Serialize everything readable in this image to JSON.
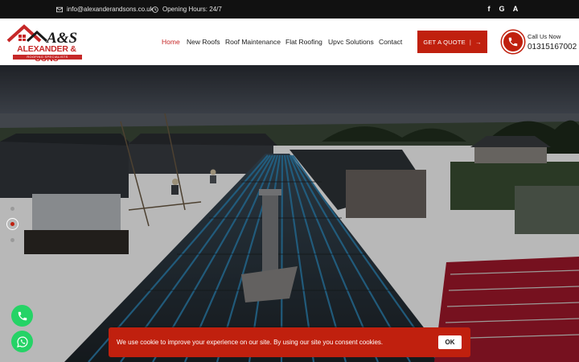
{
  "topbar": {
    "email": "info@alexanderandsons.co.uk",
    "hours": "Opening Hours: 24/7",
    "socials": [
      {
        "name": "facebook-icon",
        "glyph": "f"
      },
      {
        "name": "google-icon",
        "glyph": "G"
      },
      {
        "name": "checkatrade-icon",
        "glyph": "A"
      }
    ]
  },
  "logo": {
    "monogram": "A&S",
    "brand": "ALEXANDER & SONS",
    "tagline": "ROOFING SPECIALISTS"
  },
  "nav": {
    "items": [
      {
        "label": "Home",
        "active": true
      },
      {
        "label": "New Roofs",
        "active": false
      },
      {
        "label": "Roof Maintenance",
        "active": false
      },
      {
        "label": "Flat Roofing",
        "active": false
      },
      {
        "label": "Upvc Solutions",
        "active": false
      },
      {
        "label": "Contact",
        "active": false
      }
    ]
  },
  "cta": {
    "quote_label": "GET A QUOTE",
    "quote_sep": "|",
    "quote_arrow": "→"
  },
  "call": {
    "label": "Call Us Now",
    "number": "01315167002"
  },
  "hero": {
    "slides": 3,
    "active_slide": 2
  },
  "cookie": {
    "message": "We use cookie to improve your experience on our site. By using our site you consent cookies.",
    "ok_label": "OK"
  },
  "colors": {
    "accent": "#c0200e",
    "topbar": "#111111",
    "whatsapp": "#25d366"
  }
}
